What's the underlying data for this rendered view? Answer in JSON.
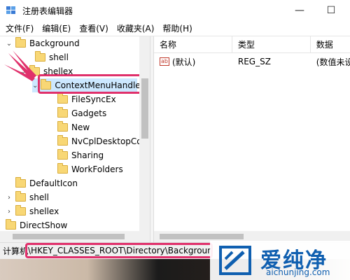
{
  "window": {
    "title": "注册表编辑器",
    "minimize_glyph": "—",
    "maximize_glyph": "☐"
  },
  "menu": [
    "文件(F)",
    "编辑(E)",
    "查看(V)",
    "收藏夹(A)",
    "帮助(H)"
  ],
  "tree": {
    "items": [
      {
        "label": "Background",
        "chevron": "⌄"
      },
      {
        "label": "shell",
        "chevron": ""
      },
      {
        "label": "shellex",
        "chevron": "⌄"
      },
      {
        "label": "ContextMenuHandlers",
        "chevron": "⌄"
      },
      {
        "label": "FileSyncEx",
        "chevron": ""
      },
      {
        "label": "Gadgets",
        "chevron": ""
      },
      {
        "label": "New",
        "chevron": ""
      },
      {
        "label": "NvCplDesktopContext",
        "chevron": ""
      },
      {
        "label": "Sharing",
        "chevron": ""
      },
      {
        "label": "WorkFolders",
        "chevron": ""
      },
      {
        "label": "DefaultIcon",
        "chevron": ""
      },
      {
        "label": "shell",
        "chevron": "›"
      },
      {
        "label": "shellex",
        "chevron": "›"
      },
      {
        "label": "DirectShow",
        "chevron": ""
      }
    ]
  },
  "list": {
    "columns": [
      "名称",
      "类型",
      "数据"
    ],
    "rows": [
      {
        "name": "(默认)",
        "type": "REG_SZ",
        "data": "(数值未设置)"
      }
    ],
    "value_icon_text": "ab"
  },
  "status": {
    "label": "计算机",
    "path": "\\HKEY_CLASSES_ROOT\\Directory\\Background\\shellex\\ContextMenuHandlers"
  },
  "watermark": {
    "cn": "爱纯净",
    "en": "aichunjing.com"
  },
  "colors": {
    "highlight": "#e0306b",
    "folder": "#f8d775",
    "watermark": "#0f5fb0"
  }
}
